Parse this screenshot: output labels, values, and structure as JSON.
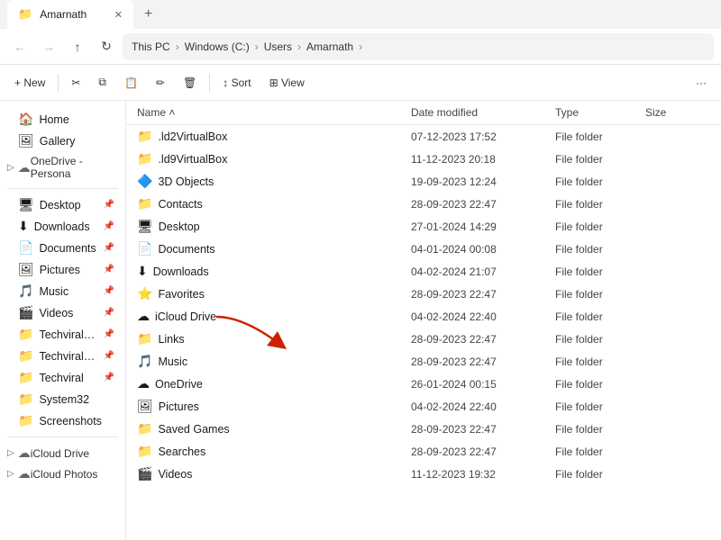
{
  "titlebar": {
    "tab_title": "Amarnath",
    "close_icon": "✕",
    "new_tab_icon": "+"
  },
  "navbar": {
    "back_tooltip": "Back",
    "forward_tooltip": "Forward",
    "up_tooltip": "Up",
    "refresh_tooltip": "Refresh",
    "breadcrumbs": [
      "This PC",
      "Windows (C:)",
      "Users",
      "Amarnath"
    ],
    "expand_icon": "›"
  },
  "toolbar": {
    "new_label": "+ New",
    "cut_icon": "✂",
    "copy_icon": "⧉",
    "paste_icon": "📋",
    "rename_icon": "✏",
    "delete_icon": "🗑",
    "sort_label": "↕ Sort",
    "view_label": "⊞ View",
    "more_icon": "···"
  },
  "sidebar": {
    "items": [
      {
        "id": "home",
        "label": "Home",
        "icon": "🏠",
        "pinned": false
      },
      {
        "id": "gallery",
        "label": "Gallery",
        "icon": "🖼",
        "pinned": false
      },
      {
        "id": "onedrive",
        "label": "OneDrive - Persona",
        "icon": "☁",
        "group": true,
        "expand": false
      }
    ],
    "pinned_items": [
      {
        "id": "desktop",
        "label": "Desktop",
        "icon": "🖥",
        "pinned": true
      },
      {
        "id": "downloads",
        "label": "Downloads",
        "icon": "⬇",
        "pinned": true
      },
      {
        "id": "documents",
        "label": "Documents",
        "icon": "📄",
        "pinned": true
      },
      {
        "id": "pictures",
        "label": "Pictures",
        "icon": "🖼",
        "pinned": true
      },
      {
        "id": "music",
        "label": "Music",
        "icon": "🎵",
        "pinned": true
      },
      {
        "id": "videos",
        "label": "Videos",
        "icon": "🎬",
        "pinned": true
      },
      {
        "id": "techviral_doc",
        "label": "Techviral Docum",
        "icon": "📁",
        "pinned": true
      },
      {
        "id": "techviral_img",
        "label": "Techviral Images",
        "icon": "📁",
        "pinned": true
      },
      {
        "id": "techviral",
        "label": "Techviral",
        "icon": "📁",
        "pinned": true
      },
      {
        "id": "system32",
        "label": "System32",
        "icon": "📁",
        "pinned": true
      },
      {
        "id": "screenshots",
        "label": "Screenshots",
        "icon": "📁",
        "pinned": true
      }
    ],
    "group_items": [
      {
        "id": "icloud_drive",
        "label": "iCloud Drive",
        "icon": "☁",
        "group": true
      },
      {
        "id": "icloud_photos",
        "label": "iCloud Photos",
        "icon": "☁",
        "group": true
      }
    ]
  },
  "file_list": {
    "columns": [
      "Name",
      "Date modified",
      "Type",
      "Size"
    ],
    "files": [
      {
        "name": ".ld2VirtualBox",
        "icon": "📁",
        "date": "07-12-2023 17:52",
        "type": "File folder",
        "size": ""
      },
      {
        "name": ".ld9VirtualBox",
        "icon": "📁",
        "date": "11-12-2023 20:18",
        "type": "File folder",
        "size": ""
      },
      {
        "name": "3D Objects",
        "icon": "🔷",
        "date": "19-09-2023 12:24",
        "type": "File folder",
        "size": ""
      },
      {
        "name": "Contacts",
        "icon": "📁",
        "date": "28-09-2023 22:47",
        "type": "File folder",
        "size": ""
      },
      {
        "name": "Desktop",
        "icon": "🖥",
        "date": "27-01-2024 14:29",
        "type": "File folder",
        "size": ""
      },
      {
        "name": "Documents",
        "icon": "📄",
        "date": "04-01-2024 00:08",
        "type": "File folder",
        "size": ""
      },
      {
        "name": "Downloads",
        "icon": "⬇",
        "date": "04-02-2024 21:07",
        "type": "File folder",
        "size": ""
      },
      {
        "name": "Favorites",
        "icon": "⭐",
        "date": "28-09-2023 22:47",
        "type": "File folder",
        "size": ""
      },
      {
        "name": "iCloud Drive",
        "icon": "☁",
        "date": "04-02-2024 22:40",
        "type": "File folder",
        "size": ""
      },
      {
        "name": "Links",
        "icon": "📁",
        "date": "28-09-2023 22:47",
        "type": "File folder",
        "size": ""
      },
      {
        "name": "Music",
        "icon": "🎵",
        "date": "28-09-2023 22:47",
        "type": "File folder",
        "size": ""
      },
      {
        "name": "OneDrive",
        "icon": "☁",
        "date": "26-01-2024 00:15",
        "type": "File folder",
        "size": ""
      },
      {
        "name": "Pictures",
        "icon": "🖼",
        "date": "04-02-2024 22:40",
        "type": "File folder",
        "size": ""
      },
      {
        "name": "Saved Games",
        "icon": "📁",
        "date": "28-09-2023 22:47",
        "type": "File folder",
        "size": ""
      },
      {
        "name": "Searches",
        "icon": "📁",
        "date": "28-09-2023 22:47",
        "type": "File folder",
        "size": ""
      },
      {
        "name": "Videos",
        "icon": "🎬",
        "date": "11-12-2023 19:32",
        "type": "File folder",
        "size": ""
      }
    ]
  },
  "arrow": {
    "color": "#cc2200"
  }
}
